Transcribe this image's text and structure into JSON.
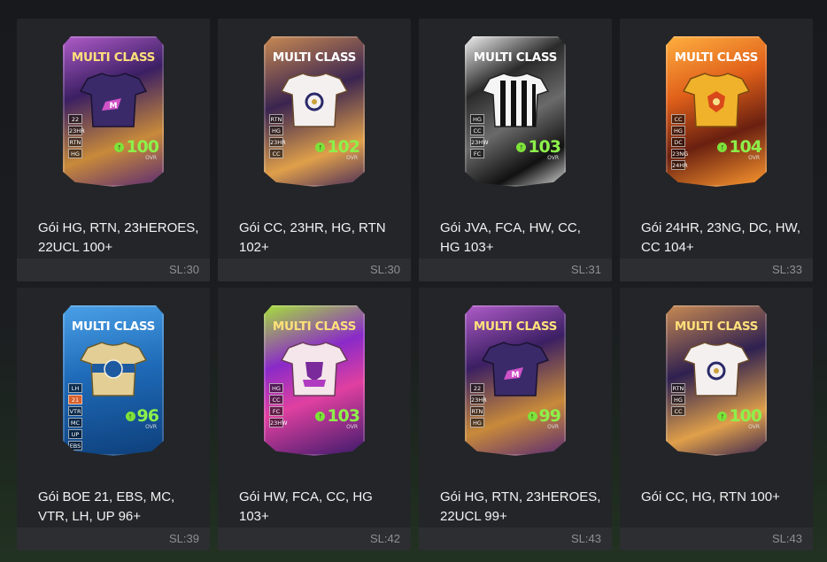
{
  "packs": [
    {
      "card_title": "MULTI CLASS",
      "name_line1": "Gói HG, RTN, 23HEROES,",
      "name_line2": "22UCL 100+",
      "ovr": "100",
      "ovr_label": "OVR",
      "sl": "SL:30",
      "badges": [
        "22",
        "23HR",
        "RTN",
        "HG"
      ],
      "theme": "purple"
    },
    {
      "card_title": "MULTI CLASS",
      "name_line1": "Gói CC, 23HR, HG, RTN",
      "name_line2": "102+",
      "ovr": "102",
      "ovr_label": "OVR",
      "sl": "SL:30",
      "badges": [
        "RTN",
        "HG",
        "23HR",
        "CC"
      ],
      "theme": "bronze"
    },
    {
      "card_title": "MULTI CLASS",
      "name_line1": "Gói JVA, FCA, HW, CC,",
      "name_line2": "HG 103+",
      "ovr": "103",
      "ovr_label": "OVR",
      "sl": "SL:31",
      "badges": [
        "HG",
        "CC",
        "23HW",
        "FC"
      ],
      "theme": "marble"
    },
    {
      "card_title": "MULTI CLASS",
      "name_line1": "Gói 24HR, 23NG, DC, HW,",
      "name_line2": "CC 104+",
      "ovr": "104",
      "ovr_label": "OVR",
      "sl": "SL:33",
      "badges": [
        "CC",
        "HG",
        "DC",
        "23NG",
        "24HR"
      ],
      "theme": "fire"
    },
    {
      "card_title": "MULTI CLASS",
      "name_line1": "Gói BOE 21, EBS, MC,",
      "name_line2": "VTR, LH, UP 96+",
      "ovr": "96",
      "ovr_label": "OVR",
      "sl": "SL:39",
      "badges": [
        "LH",
        "21",
        "VTR",
        "MC",
        "UP",
        "EBS"
      ],
      "theme": "blue"
    },
    {
      "card_title": "MULTI CLASS",
      "name_line1": "Gói HW, FCA, CC, HG",
      "name_line2": "103+",
      "ovr": "103",
      "ovr_label": "OVR",
      "sl": "SL:42",
      "badges": [
        "HG",
        "CC",
        "FC",
        "23HW"
      ],
      "theme": "neon"
    },
    {
      "card_title": "MULTI CLASS",
      "name_line1": "Gói HG, RTN, 23HEROES,",
      "name_line2": "22UCL 99+",
      "ovr": "99",
      "ovr_label": "OVR",
      "sl": "SL:43",
      "badges": [
        "22",
        "23HR",
        "RTN",
        "HG"
      ],
      "theme": "purple"
    },
    {
      "card_title": "MULTI CLASS",
      "name_line1": "Gói CC, HG, RTN 100+",
      "name_line2": "",
      "ovr": "100",
      "ovr_label": "OVR",
      "sl": "SL:43",
      "badges": [
        "RTN",
        "HG",
        "CC"
      ],
      "theme": "bronze"
    }
  ],
  "colors": {
    "ovr_green": "#8df04a",
    "panel": "#232528",
    "footer": "#2c2e31",
    "sl_text": "#8d9094"
  }
}
